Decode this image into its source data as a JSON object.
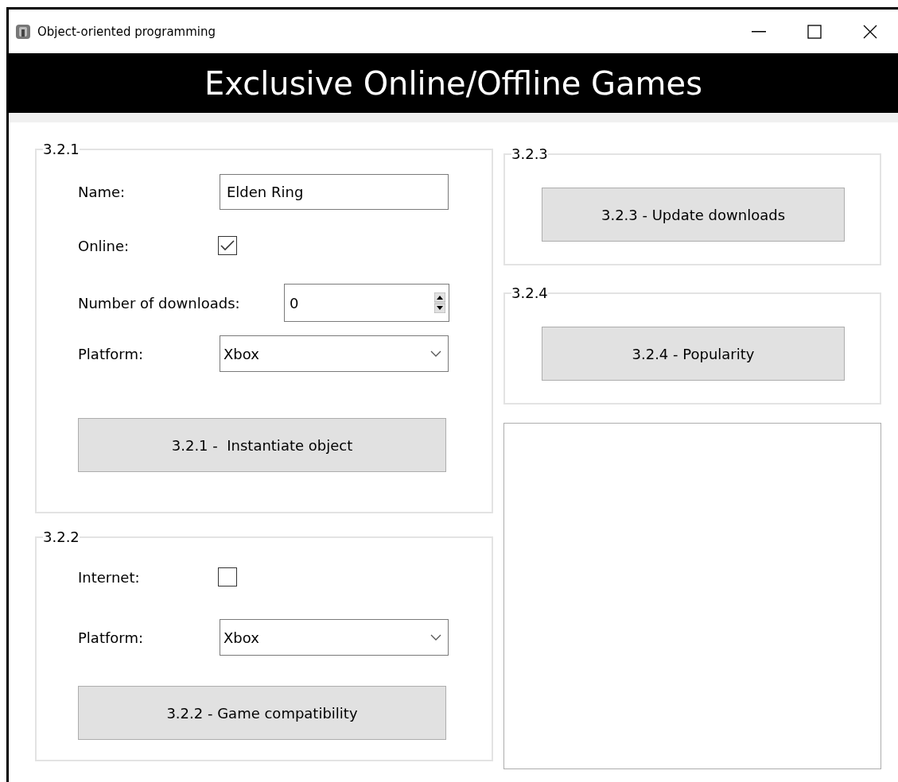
{
  "window": {
    "title": "Object-oriented programming"
  },
  "header": {
    "title": "Exclusive Online/Offline Games"
  },
  "left_groups": [
    {
      "legend": "3.2.1",
      "fields": [
        {
          "kind": "text",
          "label": "Name:",
          "value": "Elden Ring"
        },
        {
          "kind": "checkbox",
          "label": "Online:",
          "checked": true
        },
        {
          "kind": "spin",
          "label": "Number of downloads:",
          "value": "0"
        },
        {
          "kind": "combo",
          "label": "Platform:",
          "value": "Xbox"
        }
      ],
      "button": "3.2.1 -  Instantiate object"
    },
    {
      "legend": "3.2.2",
      "fields": [
        {
          "kind": "checkbox",
          "label": "Internet:",
          "checked": false
        },
        {
          "kind": "combo",
          "label": "Platform:",
          "value": "Xbox"
        }
      ],
      "button": "3.2.2 - Game compatibility"
    }
  ],
  "right_groups": [
    {
      "legend": "3.2.3",
      "button": "3.2.3 - Update downloads"
    },
    {
      "legend": "3.2.4",
      "button": "3.2.4 - Popularity"
    }
  ]
}
